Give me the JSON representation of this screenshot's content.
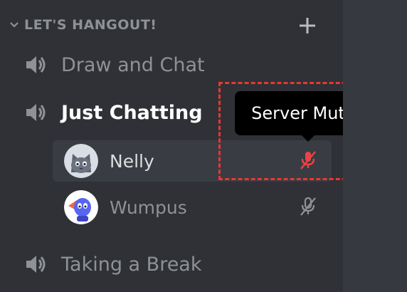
{
  "category": {
    "label": "LET'S HANGOUT!",
    "icon": "chevron-down-icon",
    "add_icon": "plus-icon"
  },
  "channels": [
    {
      "name": "Draw and Chat",
      "icon": "speaker-icon",
      "active": false
    },
    {
      "name": "Just Chatting",
      "icon": "speaker-icon",
      "active": true
    },
    {
      "name": "Taking a Break",
      "icon": "speaker-icon",
      "active": false
    }
  ],
  "voice_users": [
    {
      "name": "Nelly",
      "avatar": "cat-avatar",
      "status": "server-muted",
      "status_icon": "mic-muted-icon"
    },
    {
      "name": "Wumpus",
      "avatar": "wumpus-avatar",
      "status": "muted",
      "status_icon": "mic-muted-icon"
    }
  ],
  "tooltip": {
    "text": "Server Muted"
  },
  "colors": {
    "sidebar_bg": "#2f3136",
    "pane_bg": "#36393f",
    "hover_bg": "#393c43",
    "muted_text": "#8e9297",
    "active_text": "#ffffff",
    "server_mute_red": "#ed4245",
    "highlight_red": "#e53935"
  }
}
